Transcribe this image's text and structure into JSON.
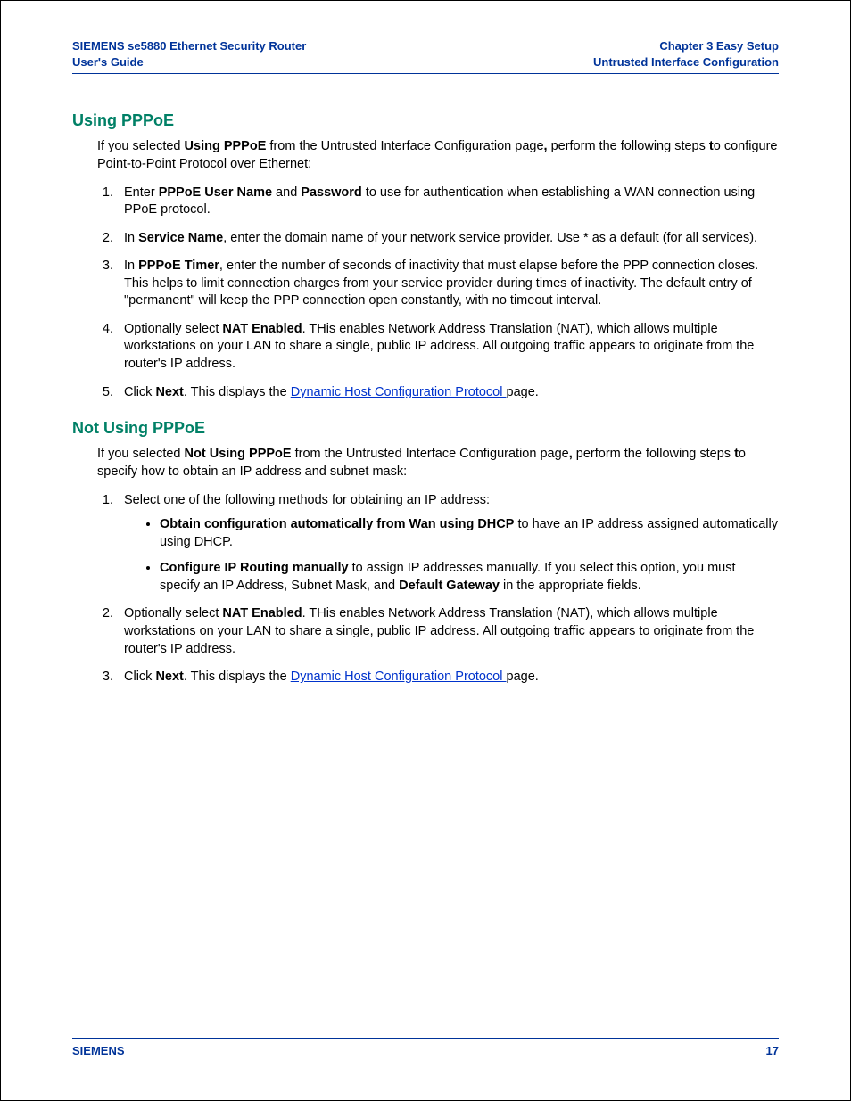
{
  "header": {
    "left_line1": "SIEMENS se5880 Ethernet Security Router",
    "left_line2": "User's Guide",
    "right_line1": "Chapter 3  Easy Setup",
    "right_line2": "Untrusted Interface Configuration"
  },
  "footer": {
    "left": "SIEMENS",
    "right": "17"
  },
  "section1": {
    "title": "Using PPPoE",
    "intro_pre": "If you selected ",
    "intro_bold": "Using PPPoE",
    "intro_mid": " from the Untrusted Interface Configuration page",
    "intro_comma": ",",
    "intro_post1": " perform the following steps ",
    "intro_t": "t",
    "intro_post2": "o configure Point-to-Point Protocol over Ethernet:",
    "steps": {
      "s1_a": "Enter ",
      "s1_b1": "PPPoE User Name",
      "s1_b": " and ",
      "s1_b2": "Password",
      "s1_c": " to use for authentication when establishing a WAN connection using PPoE protocol.",
      "s2_a": " In ",
      "s2_b": "Service Name",
      "s2_c": ", enter the domain name of your network service provider. Use * as a default (for all services).",
      "s3_a": " In ",
      "s3_b": "PPPoE Timer",
      "s3_c": ", enter the number of seconds of inactivity that must elapse before the PPP connection closes. This helps to limit connection charges from your service provider during times of inactivity. The default entry of \"permanent\" will keep the PPP connection open constantly, with no timeout interval.",
      "s4_a": " Optionally select ",
      "s4_b": "NAT Enabled",
      "s4_c": ". THis enables Network Address Translation (NAT), which allows multiple workstations on your LAN to share a single, public IP address. All outgoing traffic appears to originate from the router's IP address.",
      "s5_a": " Click ",
      "s5_b": "Next",
      "s5_c": ". This displays the ",
      "s5_link": "Dynamic Host Configuration Protocol ",
      "s5_d": "page."
    }
  },
  "section2": {
    "title": "Not Using PPPoE",
    "intro_pre": "If you selected ",
    "intro_bold": "Not Using PPPoE",
    "intro_mid": " from the Untrusted Interface Configuration page",
    "intro_comma": ",",
    "intro_post1": " perform the following steps ",
    "intro_t": "t",
    "intro_post2": "o specify how to obtain an IP address and subnet mask:",
    "steps": {
      "s1": "Select one of the following methods for obtaining an IP address:",
      "b1_b": "Obtain configuration automatically from Wan using DHCP",
      "b1_t": " to have an IP address assigned automatically using DHCP.",
      "b2_b": "Configure IP Routing manually",
      "b2_t1": " to assign IP addresses manually. If you select this option, you must specify an IP Address, Subnet Mask, and ",
      "b2_b2": "Default Gateway",
      "b2_t2": " in the appropriate fields.",
      "s2_a": " Optionally select ",
      "s2_b": "NAT Enabled",
      "s2_c": ". THis enables Network Address Translation (NAT), which allows multiple workstations on your LAN to share a single, public IP address. All outgoing traffic appears to originate from the router's IP address.",
      "s3_a": " Click ",
      "s3_b": "Next",
      "s3_c": ". This displays the ",
      "s3_link": "Dynamic Host Configuration Protocol ",
      "s3_d": "page."
    }
  }
}
